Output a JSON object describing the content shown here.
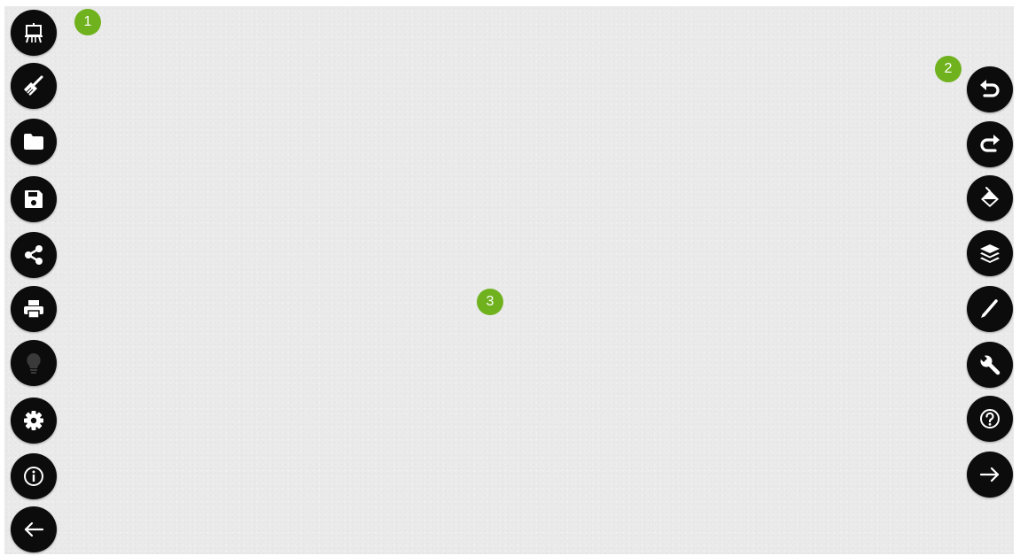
{
  "markers": {
    "m1": "1",
    "m2": "2",
    "m3": "3"
  },
  "colors": {
    "canvas": "#eaeaea",
    "button": "#0c0c0c",
    "icon": "#ffffff",
    "marker": "#6fb21e"
  },
  "left_toolbar": [
    {
      "icon": "easel-icon",
      "action": "board"
    },
    {
      "icon": "broom-icon",
      "action": "clear"
    },
    {
      "icon": "folder-icon",
      "action": "open"
    },
    {
      "icon": "floppy-disk-icon",
      "action": "save"
    },
    {
      "icon": "share-icon",
      "action": "share"
    },
    {
      "icon": "printer-icon",
      "action": "print"
    },
    {
      "icon": "lightbulb-icon",
      "action": "hint",
      "state": "disabled"
    },
    {
      "icon": "gear-icon",
      "action": "settings"
    },
    {
      "icon": "info-icon",
      "action": "info"
    },
    {
      "icon": "arrow-left-icon",
      "action": "back"
    }
  ],
  "right_toolbar": [
    {
      "icon": "undo-icon",
      "action": "undo"
    },
    {
      "icon": "redo-icon",
      "action": "redo"
    },
    {
      "icon": "fill-bucket-icon",
      "action": "fill"
    },
    {
      "icon": "layers-icon",
      "action": "layers"
    },
    {
      "icon": "pencil-icon",
      "action": "pen"
    },
    {
      "icon": "wrench-icon",
      "action": "tools"
    },
    {
      "icon": "help-icon",
      "action": "help"
    },
    {
      "icon": "arrow-right-icon",
      "action": "next"
    }
  ]
}
